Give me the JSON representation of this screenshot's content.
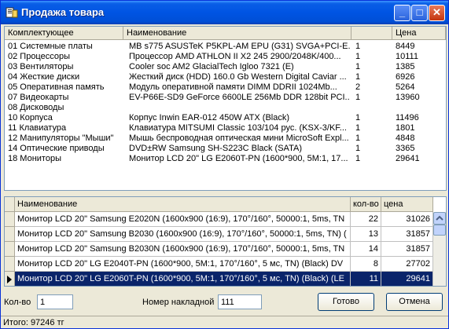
{
  "window": {
    "title": "Продажа товара"
  },
  "list1": {
    "headers": {
      "component": "Комплектующее",
      "name": "Наименование",
      "qty": "",
      "price": "Цена"
    },
    "rows": [
      {
        "component": "01 Системные платы",
        "name": "MB s775 ASUSTeK P5KPL-AM EPU (G31) SVGA+PCI-E...",
        "qty": "1",
        "price": "8449"
      },
      {
        "component": "02 Процессоры",
        "name": "Процессор AMD ATHLON II X2  245  2900/2048K/400...",
        "qty": "1",
        "price": "10111"
      },
      {
        "component": "03 Вентиляторы",
        "name": "Cooler soc AM2 GlacialTech  Igloo 7321 (E)",
        "qty": "1",
        "price": "1385"
      },
      {
        "component": "04 Жесткие диски",
        "name": "Жесткий диск (HDD) 160.0 Gb  Western Digital Caviar ...",
        "qty": "1",
        "price": "6926"
      },
      {
        "component": "05 Оперативная память",
        "name": "Модуль оперативной памяти DIMM    DDRII    1024Mb...",
        "qty": "2",
        "price": "5264"
      },
      {
        "component": "07 Видеокарты",
        "name": "EV-P66E-SD9 GeForce 6600LE 256Mb DDR 128bit PCI...",
        "qty": "1",
        "price": "13960"
      },
      {
        "component": "08 Дисководы",
        "name": "",
        "qty": "",
        "price": ""
      },
      {
        "component": "10 Корпуса",
        "name": "Корпус Inwin EAR-012  450W ATX (Black)",
        "qty": "1",
        "price": "11496"
      },
      {
        "component": "11 Клавиатура",
        "name": "Клавиатура MITSUMI Classic 103/104 рус. (KSX-3/KF...",
        "qty": "1",
        "price": "1801"
      },
      {
        "component": "12 Манипуляторы \"Мыши\"",
        "name": "Мышь беспроводная оптическая мини MicroSoft Expl...",
        "qty": "1",
        "price": "4848"
      },
      {
        "component": "14 Оптические приводы",
        "name": "DVD±RW Samsung SH-S223C  Black  (SATA)",
        "qty": "1",
        "price": "3365"
      },
      {
        "component": "18 Мониторы",
        "name": "Монитор  LCD 20\" LG E2060T-PN (1600*900, 5M:1, 17...",
        "qty": "1",
        "price": "29641"
      }
    ]
  },
  "grid2": {
    "headers": {
      "name": "Наименование",
      "qty": "кол-во",
      "price": "цена"
    },
    "rows": [
      {
        "name": "Монитор  LCD 20\" Samsung E2020N  (1600x900 (16:9), 170°/160°, 50000:1, 5ms, TN",
        "qty": "22",
        "price": "31026"
      },
      {
        "name": "Монитор  LCD 20\" Samsung B2030 (1600x900 (16:9), 170°/160°, 50000:1, 5ms, TN) (",
        "qty": "13",
        "price": "31857"
      },
      {
        "name": "Монитор  LCD 20\" Samsung B2030N (1600x900 (16:9), 170°/160°, 50000:1, 5ms, TN",
        "qty": "14",
        "price": "31857"
      },
      {
        "name": "Монитор  LCD 20\" LG E2040T-PN (1600*900, 5M:1, 170°/160°, 5 мс, TN) (Black) DV",
        "qty": "8",
        "price": "27702"
      },
      {
        "name": "Монитор  LCD 20\" LG E2060T-PN (1600*900, 5M:1, 170°/160°, 5 мс, TN) (Black) (LE",
        "qty": "11",
        "price": "29641"
      }
    ]
  },
  "form": {
    "qty_label": "Кол-во",
    "qty_value": "1",
    "invoice_label": "Номер накладной",
    "invoice_value": "111",
    "ok_label": "Готово",
    "cancel_label": "Отмена"
  },
  "status": {
    "text": "Итого: 97246 тг"
  }
}
